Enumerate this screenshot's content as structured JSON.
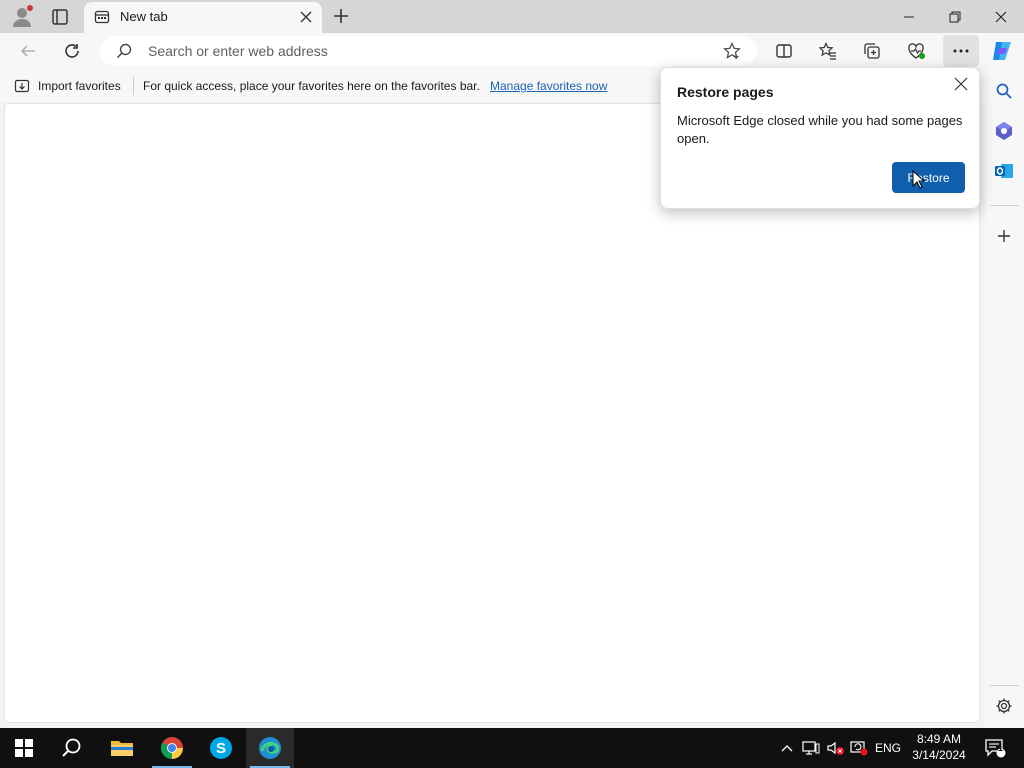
{
  "tab": {
    "title": "New tab"
  },
  "address_bar": {
    "placeholder": "Search or enter web address"
  },
  "favorites_bar": {
    "import_label": "Import favorites",
    "message": "For quick access, place your favorites here on the favorites bar.",
    "link": "Manage favorites now"
  },
  "popup": {
    "title": "Restore pages",
    "body": "Microsoft Edge closed while you had some pages open.",
    "button": "Restore"
  },
  "taskbar": {
    "language": "ENG",
    "time": "8:49 AM",
    "date": "3/14/2024",
    "notification_count": "1"
  },
  "colors": {
    "accent": "#0f5fad",
    "link": "#1a62b8",
    "taskbar": "#101010"
  }
}
